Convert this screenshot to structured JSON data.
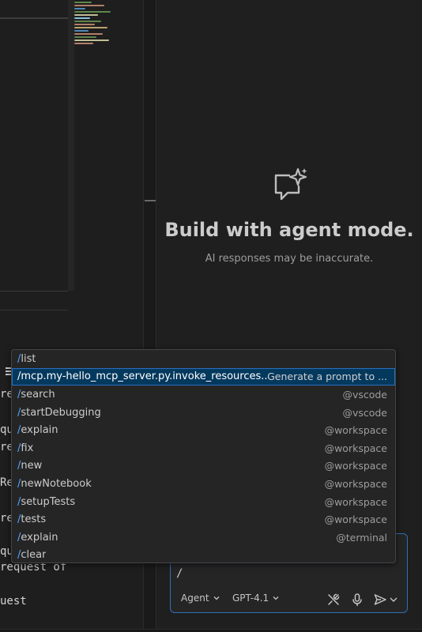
{
  "editor": {
    "code_lines": [
      "re",
      "qu",
      "re",
      "Re",
      "re",
      "qu",
      "request of",
      "uest"
    ]
  },
  "chat": {
    "empty_title": "Build with agent mode.",
    "empty_subtitle": "AI responses may be inaccurate.",
    "input_value": "/",
    "mode_label": "Agent",
    "model_label": "GPT-4.1",
    "icons": [
      "tools-icon",
      "microphone-icon",
      "send-icon",
      "chevron-down-icon"
    ]
  },
  "popup": {
    "items": [
      {
        "command": "list",
        "meta": ""
      },
      {
        "command": "mcp.my-hello_mcp_server.py.invoke_resources...",
        "meta": "Generate a prompt to ..."
      },
      {
        "command": "search",
        "meta": "@vscode"
      },
      {
        "command": "startDebugging",
        "meta": "@vscode"
      },
      {
        "command": "explain",
        "meta": "@workspace"
      },
      {
        "command": "fix",
        "meta": "@workspace"
      },
      {
        "command": "new",
        "meta": "@workspace"
      },
      {
        "command": "newNotebook",
        "meta": "@workspace"
      },
      {
        "command": "setupTests",
        "meta": "@workspace"
      },
      {
        "command": "tests",
        "meta": "@workspace"
      },
      {
        "command": "explain",
        "meta": "@terminal"
      },
      {
        "command": "clear",
        "meta": ""
      }
    ],
    "selected_index": 1
  },
  "colors": {
    "accent": "#2f6fb5",
    "selection": "#04395e",
    "slash": "#4fa8ff"
  }
}
